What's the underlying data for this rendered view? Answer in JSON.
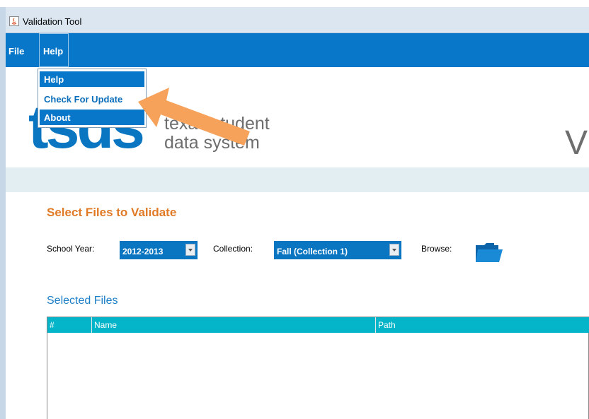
{
  "window": {
    "title": "Validation Tool"
  },
  "menubar": {
    "file": "File",
    "help": "Help"
  },
  "help_menu": {
    "items": [
      "Help",
      "Check For Update",
      "About"
    ],
    "highlighted_index": 1
  },
  "logo": {
    "abbrev": "tsds",
    "line1": "texas student",
    "line2": "data system",
    "app_initial": "V"
  },
  "form": {
    "heading": "Select Files to Validate",
    "school_year_label": "School Year:",
    "school_year_value": "2012-2013",
    "collection_label": "Collection:",
    "collection_value": "Fall (Collection 1)",
    "browse_label": "Browse:"
  },
  "files": {
    "heading": "Selected Files",
    "columns": [
      "#",
      "Name",
      "Path"
    ]
  },
  "colors": {
    "accent": "#0877c9",
    "heading_orange": "#e07a25",
    "table_header": "#04b4c8",
    "callout_arrow": "#f6a25a"
  },
  "icons": [
    "java-app-icon",
    "folder-icon",
    "callout-arrow"
  ]
}
